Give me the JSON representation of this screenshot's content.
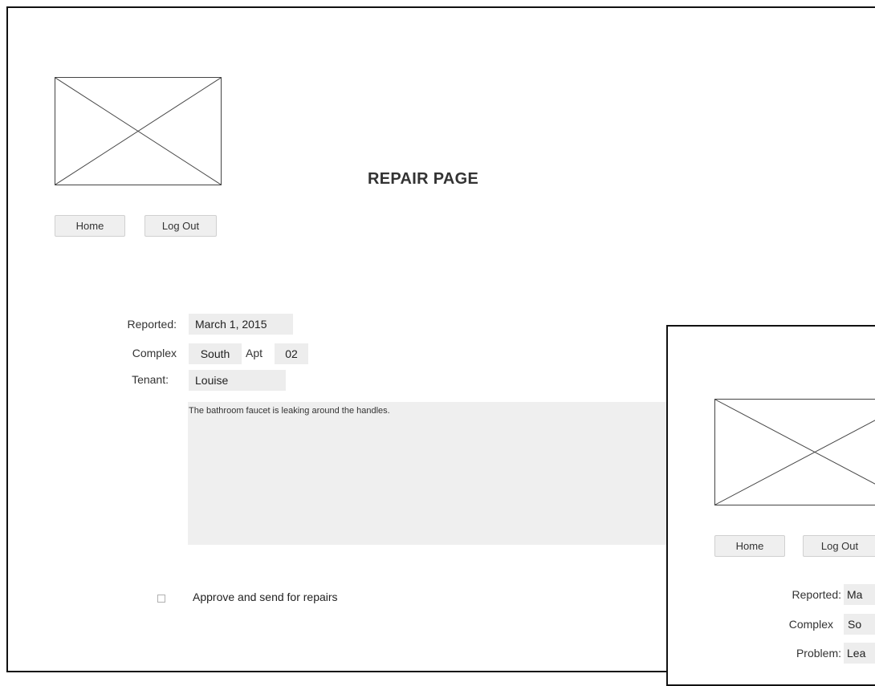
{
  "page": {
    "title": "REPAIR PAGE"
  },
  "nav": {
    "home_label": "Home",
    "logout_label": "Log Out"
  },
  "form": {
    "reported_label": "Reported:",
    "reported_value": "March 1, 2015",
    "complex_label": "Complex",
    "complex_value": "South",
    "apt_label": "Apt",
    "apt_value": "02",
    "tenant_label": "Tenant:",
    "tenant_value": "Louise",
    "description": "The bathroom faucet is leaking around the handles.",
    "approve_label": "Approve and send for repairs",
    "approve_checked": false
  },
  "overlay": {
    "home_label": "Home",
    "logout_label": "Log Out",
    "reported_label": "Reported:",
    "reported_value": "Ma",
    "complex_label": "Complex",
    "complex_value": "So",
    "problem_label": "Problem:",
    "problem_value": "Lea"
  }
}
